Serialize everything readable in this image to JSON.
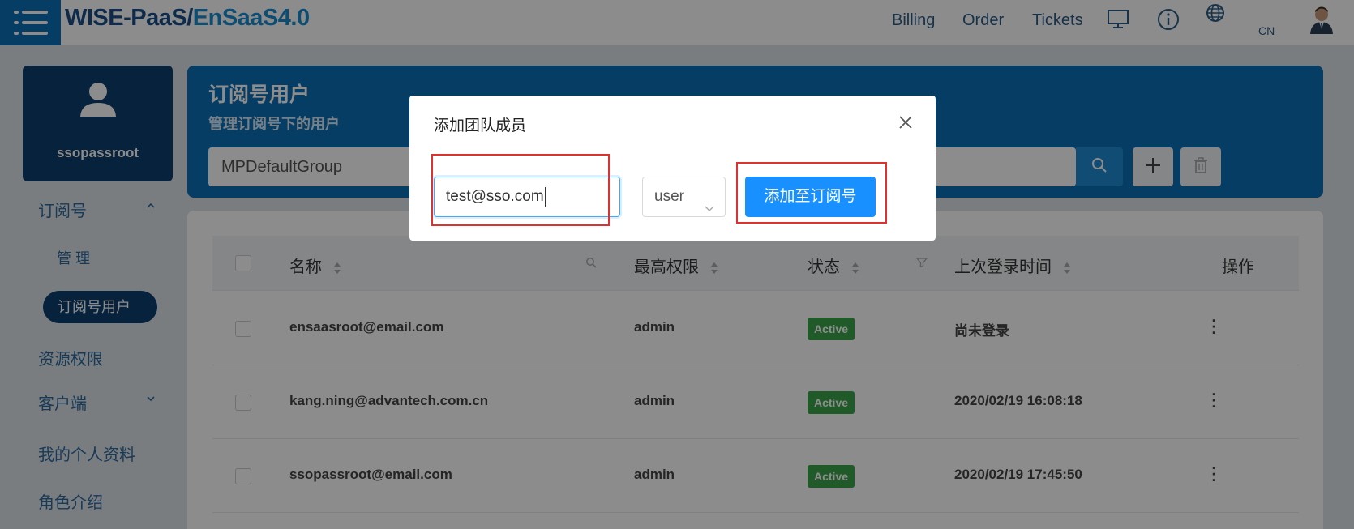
{
  "header": {
    "brand_part1": "WISE-PaaS/",
    "brand_part2": "EnSaaS4.0",
    "nav": [
      "Billing",
      "Order",
      "Tickets"
    ],
    "lang": "CN",
    "icons": [
      "menu-icon",
      "monitor-icon",
      "info-icon",
      "globe-icon",
      "user-avatar-icon"
    ]
  },
  "sidebar": {
    "username": "ssopassroot",
    "items": [
      {
        "label": "订阅号"
      },
      {
        "label": "管 理"
      },
      {
        "label": "订阅号用户"
      },
      {
        "label": "资源权限"
      },
      {
        "label": "客户端"
      },
      {
        "label": "我的个人资料"
      },
      {
        "label": "角色介绍"
      }
    ]
  },
  "hero": {
    "title": "订阅号用户",
    "subtitle": "管理订阅号下的用户",
    "group_value": "MPDefaultGroup"
  },
  "table": {
    "headers": [
      "名称",
      "最高权限",
      "状态",
      "上次登录时间",
      "操作"
    ],
    "rows": [
      {
        "name": "ensaasroot@email.com",
        "role": "admin",
        "status": "Active",
        "last_login": "尚未登录"
      },
      {
        "name": "kang.ning@advantech.com.cn",
        "role": "admin",
        "status": "Active",
        "last_login": "2020/02/19 16:08:18"
      },
      {
        "name": "ssopassroot@email.com",
        "role": "admin",
        "status": "Active",
        "last_login": "2020/02/19 17:45:50"
      }
    ]
  },
  "modal": {
    "title": "添加团队成员",
    "email_value": "test@sso.com",
    "role_value": "user",
    "add_button": "添加至订阅号"
  },
  "colors": {
    "brand_blue": "#0b6fb8",
    "navy": "#0c3f6e",
    "primary_button": "#1890ff",
    "active_badge": "#3aa54a",
    "highlight_red": "#e03131"
  }
}
